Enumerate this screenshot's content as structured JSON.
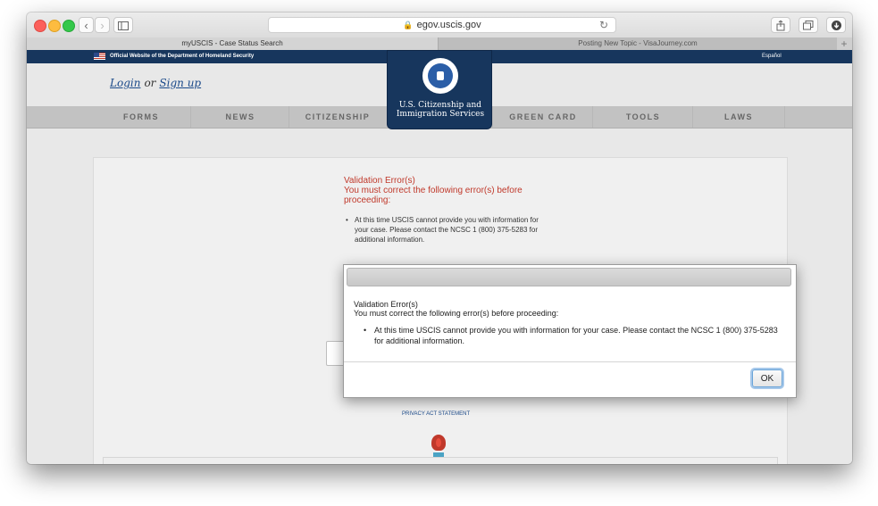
{
  "browser": {
    "address": "egov.uscis.gov",
    "tabs": [
      {
        "label": "myUSCIS - Case Status Search",
        "active": true
      },
      {
        "label": "Posting New Topic - VisaJourney.com",
        "active": false
      }
    ],
    "new_tab": "+",
    "icons": {
      "back": "chevron-left-icon",
      "forward": "chevron-right-icon",
      "sidebar": "sidebar-icon",
      "lock": "lock-icon",
      "reload": "reload-icon",
      "share": "share-icon",
      "tabs": "tab-overview-icon",
      "downloads": "download-icon"
    }
  },
  "site": {
    "official": "Official Website of the Department of Homeland Security",
    "espanol": "Español",
    "login": "Login",
    "or": "or",
    "signup": "Sign up",
    "logo_text_1": "U.S. Citizenship and",
    "logo_text_2": "Immigration Services",
    "nav": [
      "FORMS",
      "NEWS",
      "CITIZENSHIP",
      "GREEN CARD",
      "TOOLS",
      "LAWS"
    ],
    "privacy": "PRIVACY ACT STATEMENT"
  },
  "page_error": {
    "title": "Validation Error(s)",
    "subtitle_1": "You must correct the following error(s) before",
    "subtitle_2": "proceeding:",
    "bullet": "•",
    "item": "At this time USCIS cannot provide you with information for your case. Please contact the NCSC 1 (800) 375-5283 for additional information."
  },
  "dialog": {
    "line1": "Validation Error(s)",
    "line2": "You must correct the following error(s) before proceeding:",
    "bullet": "•",
    "item": "At this time USCIS cannot provide you with information for your case. Please contact the NCSC 1 (800) 375-5283 for additional information.",
    "ok": "OK"
  },
  "colors": {
    "header_blue": "#17365d",
    "error_red": "#c0392b",
    "link_blue": "#1b4a8a"
  }
}
